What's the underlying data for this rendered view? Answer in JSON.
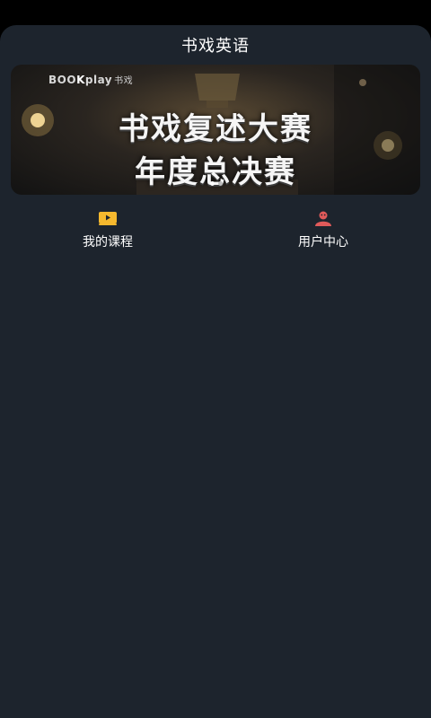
{
  "app": {
    "title": "书戏英语"
  },
  "banner": {
    "logo_prefix": "BOO",
    "logo_ok": "K",
    "logo_play": "play",
    "logo_cn": "书戏",
    "line1": "书戏复述大赛",
    "line2": "年度总决赛",
    "slide_count": 2,
    "active_slide": 1
  },
  "nav": {
    "items": [
      {
        "label": "我的课程",
        "icon": "play-icon",
        "color": "#f5b82e"
      },
      {
        "label": "用户中心",
        "icon": "user-icon",
        "color": "#e05a5a"
      }
    ]
  },
  "colors": {
    "background": "#1d242d",
    "status_bar": "#000000",
    "text": "#ffffff"
  }
}
